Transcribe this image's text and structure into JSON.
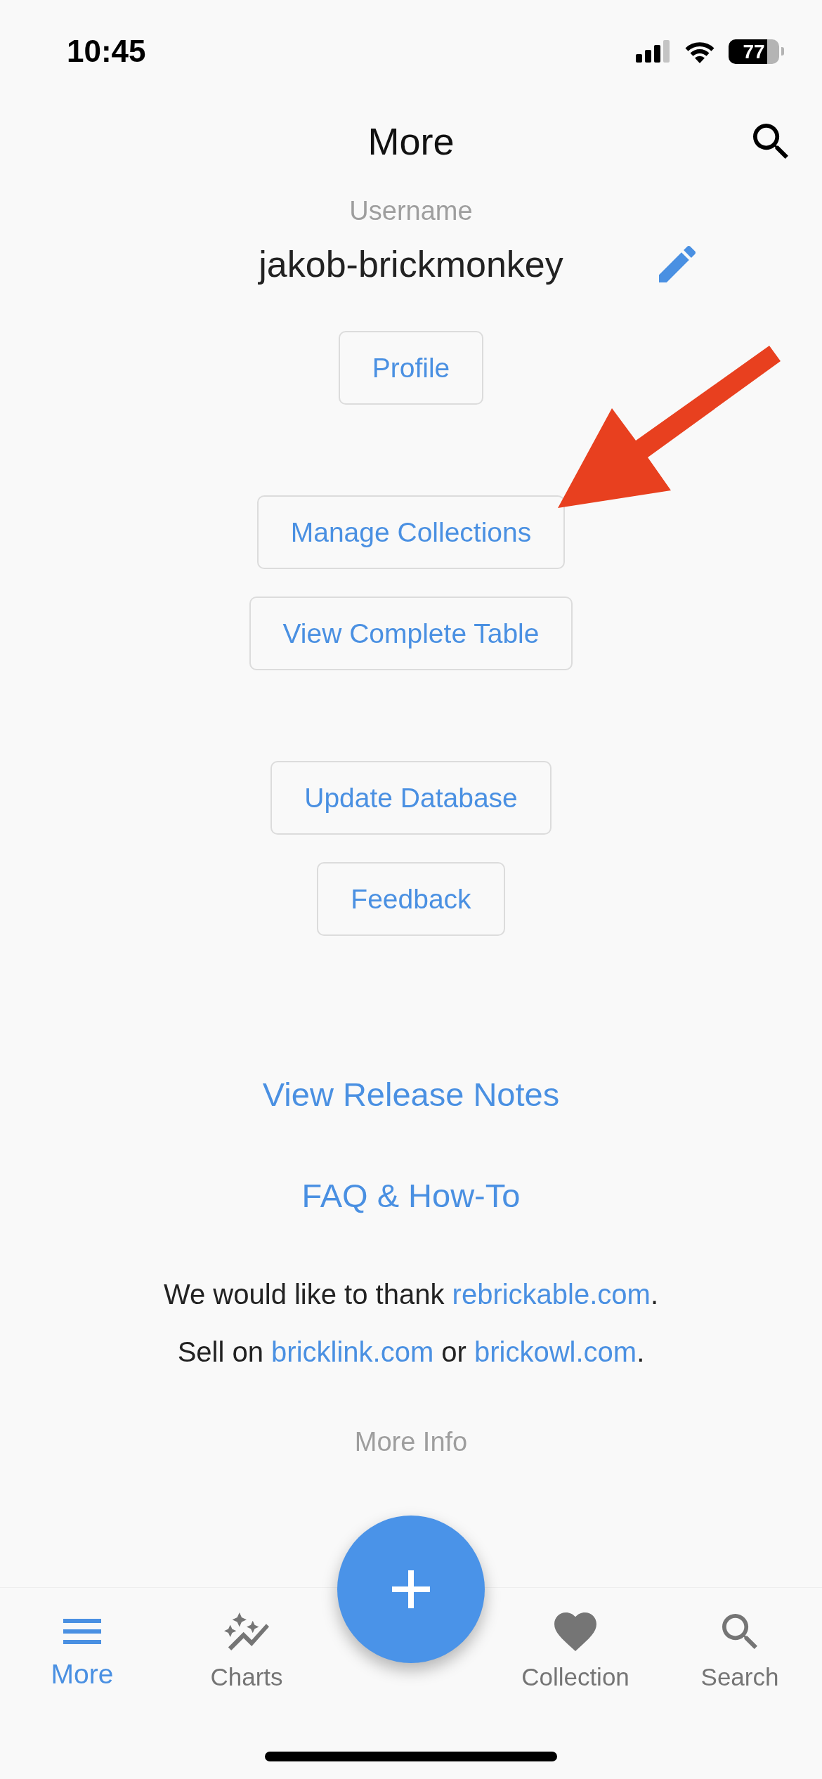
{
  "status_bar": {
    "time": "10:45",
    "battery": "77"
  },
  "header": {
    "title": "More"
  },
  "profile": {
    "label": "Username",
    "username": "jakob-brickmonkey"
  },
  "button_groups": [
    [
      "Profile"
    ],
    [
      "Manage Collections",
      "View Complete Table"
    ],
    [
      "Update Database",
      "Feedback"
    ]
  ],
  "links": [
    "View Release Notes",
    "FAQ & How-To"
  ],
  "credits": [
    [
      {
        "kind": "text",
        "text": "We would like to thank "
      },
      {
        "kind": "link",
        "text": "rebrickable.com"
      },
      {
        "kind": "text",
        "text": "."
      }
    ],
    [
      {
        "kind": "text",
        "text": "Sell on "
      },
      {
        "kind": "link",
        "text": "bricklink.com"
      },
      {
        "kind": "text",
        "text": " or "
      },
      {
        "kind": "link",
        "text": "brickowl.com"
      },
      {
        "kind": "text",
        "text": "."
      }
    ]
  ],
  "more_info": "More Info",
  "tab_bar": {
    "tabs": [
      {
        "label": "More",
        "selected": true
      },
      {
        "label": "Charts",
        "selected": false
      },
      {
        "label": "Collection",
        "selected": false
      },
      {
        "label": "Search",
        "selected": false
      }
    ]
  }
}
